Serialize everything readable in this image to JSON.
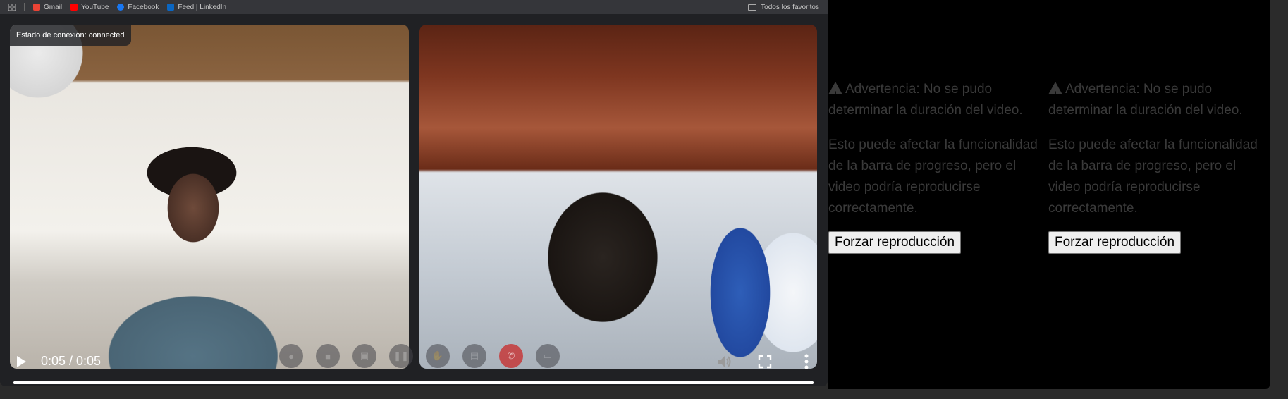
{
  "bookmarks": {
    "items": [
      {
        "label": "Gmail",
        "icon": "gmail-icon",
        "color": "#ea4335"
      },
      {
        "label": "YouTube",
        "icon": "youtube-icon",
        "color": "#ff0000"
      },
      {
        "label": "Facebook",
        "icon": "facebook-icon",
        "color": "#1877f2"
      },
      {
        "label": "Feed | LinkedIn",
        "icon": "linkedin-icon",
        "color": "#0a66c2"
      }
    ],
    "all_favorites": "Todos los favoritos"
  },
  "call": {
    "connection_status": "Estado de conexión: connected",
    "toolbar": [
      "mic",
      "camera",
      "screen-share",
      "pause",
      "hand",
      "record",
      "hang-up",
      "chat"
    ]
  },
  "video": {
    "time": "0:05 / 0:05",
    "progress": 1.0
  },
  "warnings": [
    {
      "title": "Advertencia: No se pudo determinar la duración del video.",
      "body": "Esto puede afectar la funcionalidad de la barra de progreso, pero el video podría reproducirse correctamente.",
      "button": "Forzar reproducción"
    },
    {
      "title": "Advertencia: No se pudo determinar la duración del video.",
      "body": "Esto puede afectar la funcionalidad de la barra de progreso, pero el video podría reproducirse correctamente.",
      "button": "Forzar reproducción"
    }
  ],
  "colors": {
    "warning_text": "#3a3a3a",
    "panel_bg": "#000000",
    "page_bg": "#2b2b2b"
  }
}
